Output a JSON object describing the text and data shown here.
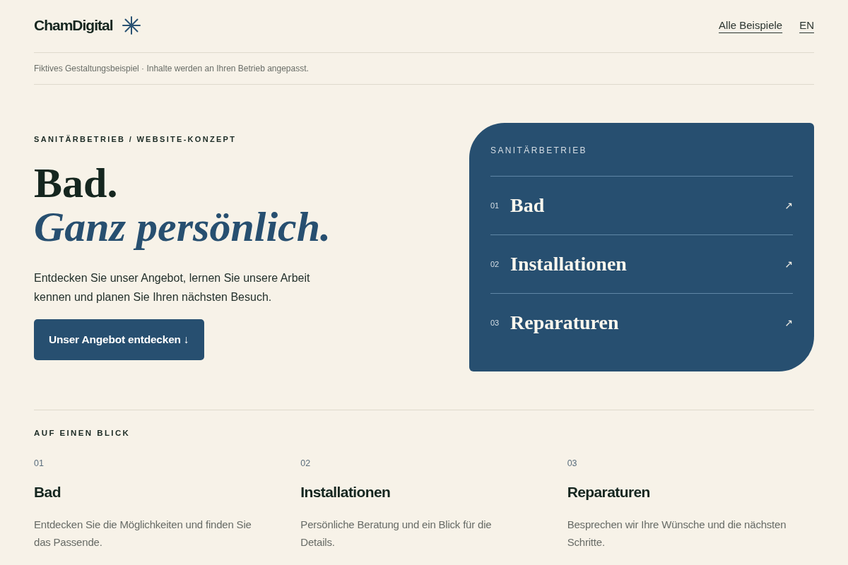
{
  "header": {
    "logo": "ChamDigital",
    "nav": [
      {
        "label": "Alle Beispiele"
      },
      {
        "label": "EN"
      }
    ]
  },
  "notice": "Fiktives Gestaltungsbeispiel · Inhalte werden an Ihren Betrieb angepasst.",
  "hero": {
    "eyebrow": "SANITÄRBETRIEB / WEBSITE-KONZEPT",
    "title_line_1": "Bad.",
    "title_line_2": "Ganz persönlich.",
    "intro": "Entdecken Sie unser Angebot, lernen Sie unsere Arbeit kennen und planen Sie Ihren nächsten Besuch.",
    "cta": "Unser Angebot entdecken ↓"
  },
  "service_card": {
    "label": "SANITÄRBETRIEB",
    "items": [
      {
        "number": "01",
        "title": "Bad",
        "arrow": "↗"
      },
      {
        "number": "02",
        "title": "Installationen",
        "arrow": "↗"
      },
      {
        "number": "03",
        "title": "Reparaturen",
        "arrow": "↗"
      }
    ]
  },
  "overview": {
    "heading": "AUF EINEN BLICK",
    "items": [
      {
        "number": "01",
        "title": "Bad",
        "text": "Entdecken Sie die Möglichkeiten und finden Sie das Passende."
      },
      {
        "number": "02",
        "title": "Installationen",
        "text": "Persönliche Beratung und ein Blick für die Details."
      },
      {
        "number": "03",
        "title": "Reparaturen",
        "text": "Besprechen wir Ihre Wünsche und die nächsten Schritte."
      }
    ]
  }
}
